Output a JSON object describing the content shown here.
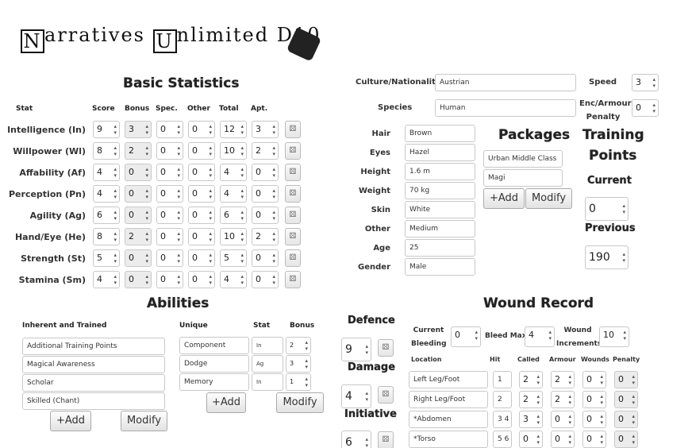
{
  "header": {
    "logo_text": "Narratives Unlimited D10",
    "logo_part1": "arratives",
    "logo_part2": "nlimited",
    "logo_part3": "D10",
    "logo_n": "N",
    "logo_u": "U",
    "dice_label": "d10"
  },
  "basic": {
    "title": "Basic Statistics",
    "cols": [
      "Stat",
      "Score",
      "Bonus",
      "Spec.",
      "Other",
      "Total",
      "Apt."
    ],
    "rows": [
      {
        "label": "Intelligence (In)",
        "score": "9",
        "bonus": "3",
        "spec": "0",
        "other": "0",
        "total": "12",
        "apt": "3"
      },
      {
        "label": "Willpower (Wl)",
        "score": "8",
        "bonus": "2",
        "spec": "0",
        "other": "0",
        "total": "10",
        "apt": "2"
      },
      {
        "label": "Affability (Af)",
        "score": "4",
        "bonus": "0",
        "spec": "0",
        "other": "0",
        "total": "4",
        "apt": "0"
      },
      {
        "label": "Perception (Pn)",
        "score": "4",
        "bonus": "0",
        "spec": "0",
        "other": "0",
        "total": "4",
        "apt": "0"
      },
      {
        "label": "Agility (Ag)",
        "score": "6",
        "bonus": "0",
        "spec": "0",
        "other": "0",
        "total": "6",
        "apt": "0"
      },
      {
        "label": "Hand/Eye (He)",
        "score": "8",
        "bonus": "2",
        "spec": "0",
        "other": "0",
        "total": "10",
        "apt": "2"
      },
      {
        "label": "Strength (St)",
        "score": "5",
        "bonus": "0",
        "spec": "0",
        "other": "0",
        "total": "5",
        "apt": "0"
      },
      {
        "label": "Stamina (Sm)",
        "score": "4",
        "bonus": "0",
        "spec": "0",
        "other": "0",
        "total": "4",
        "apt": "0"
      }
    ]
  },
  "profile": {
    "culture_label": "Culture/Nationality",
    "culture": "Austrian",
    "species_label": "Species",
    "species": "Human",
    "speed_label": "Speed",
    "speed": "3",
    "enc_label": "Enc/Armour Penalty",
    "enc": "0",
    "fields": [
      {
        "label": "Hair",
        "value": "Brown"
      },
      {
        "label": "Eyes",
        "value": "Hazel"
      },
      {
        "label": "Height",
        "value": "1.6 m"
      },
      {
        "label": "Weight",
        "value": "70 kg"
      },
      {
        "label": "Skin",
        "value": "White"
      },
      {
        "label": "Other",
        "value": "Medium"
      },
      {
        "label": "Age",
        "value": "25"
      },
      {
        "label": "Gender",
        "value": "Male"
      }
    ]
  },
  "packages": {
    "title": "Packages",
    "items": [
      "Urban Middle Class",
      "Magi"
    ],
    "add": "+Add",
    "modify": "Modify"
  },
  "training": {
    "title1": "Training",
    "title2": "Points",
    "current_label": "Current",
    "current": "0",
    "previous_label": "Previous",
    "previous": "190"
  },
  "abilities": {
    "title": "Abilities",
    "inherent_header": "Inherent and Trained",
    "inherent": [
      "Additional Training Points",
      "Magical Awareness",
      "Scholar",
      "Skilled (Chant)"
    ],
    "unique_header": "Unique",
    "stat_header": "Stat",
    "bonus_header": "Bonus",
    "unique": [
      {
        "name": "Component Improv.",
        "stat": "In",
        "bonus": "2"
      },
      {
        "name": "Dodge",
        "stat": "Ag",
        "bonus": "3"
      },
      {
        "name": "Memory",
        "stat": "In",
        "bonus": "1"
      }
    ],
    "add": "+Add",
    "modify": "Modify"
  },
  "combat": {
    "defence_label": "Defence",
    "defence": "9",
    "damage_label": "Damage",
    "damage": "4",
    "initiative_label": "Initiative",
    "initiative": "6"
  },
  "wound": {
    "title": "Wound Record",
    "current_bleeding_label": "Current Bleeding",
    "current_bleeding": "0",
    "bleed_max_label": "Bleed Max",
    "bleed_max": "4",
    "wound_inc_label": "Wound Increments",
    "wound_inc": "10",
    "cols": [
      "Location",
      "Hit",
      "Called",
      "Armour",
      "Wounds",
      "Penalty"
    ],
    "rows": [
      {
        "location": "Left Leg/Foot",
        "hit": "1",
        "called": "2",
        "armour": "2",
        "wounds": "0",
        "penalty": "0"
      },
      {
        "location": "Right Leg/Foot",
        "hit": "2",
        "called": "2",
        "armour": "2",
        "wounds": "0",
        "penalty": "0"
      },
      {
        "location": "*Abdomen",
        "hit": "3 4",
        "called": "3",
        "armour": "0",
        "wounds": "0",
        "penalty": "0"
      },
      {
        "location": "*Torso",
        "hit": "5 6",
        "called": "0",
        "armour": "0",
        "wounds": "0",
        "penalty": "0"
      }
    ]
  },
  "icons": {
    "roll": "dice-roll-icon"
  }
}
